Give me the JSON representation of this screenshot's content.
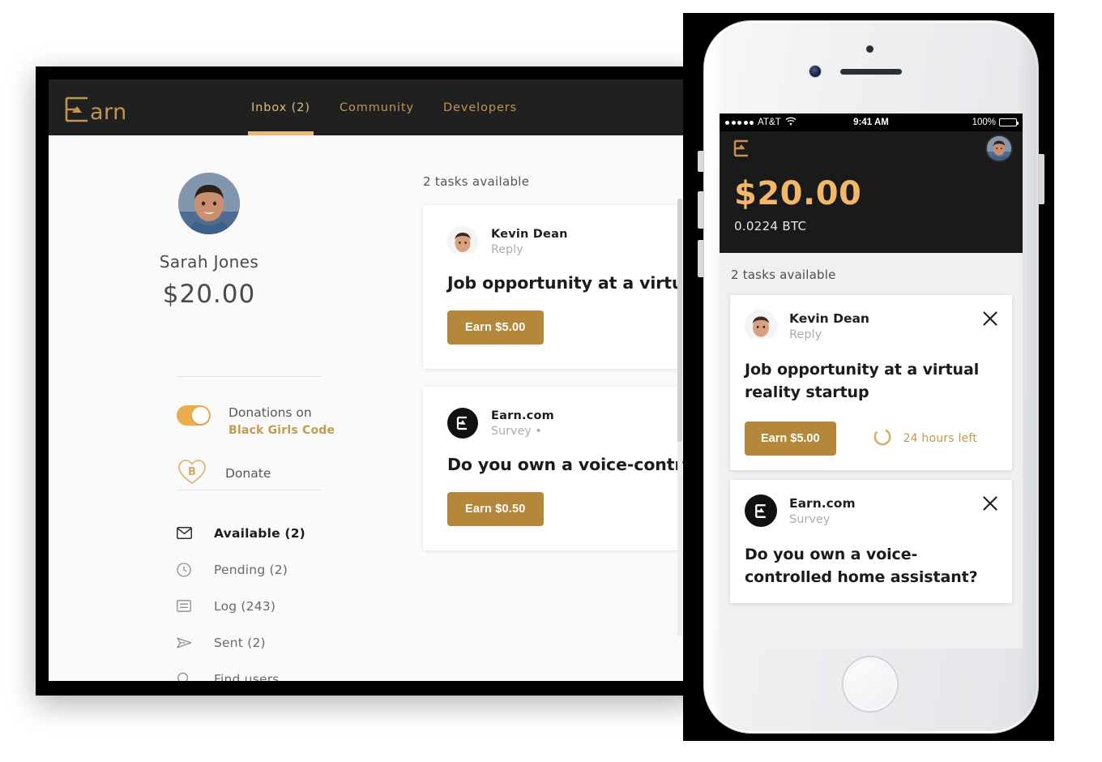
{
  "desktop": {
    "header": {
      "logo_text": "Earn",
      "logo_icon": "earn-logo-icon",
      "tabs": [
        {
          "label": "Inbox (2)",
          "active": true
        },
        {
          "label": "Community",
          "active": false
        },
        {
          "label": "Developers",
          "active": false
        }
      ]
    },
    "sidebar": {
      "avatar": "user-avatar",
      "name": "Sarah Jones",
      "balance": "$20.00",
      "donation": {
        "toggle_state": "on",
        "label": "Donations on",
        "organization": "Black Girls Code"
      },
      "donate": {
        "icon": "bitcoin-heart-icon",
        "label": "Donate"
      },
      "nav_items": [
        {
          "label": "Available (2)",
          "icon": "envelope-icon",
          "active": true
        },
        {
          "label": "Pending (2)",
          "icon": "clock-icon",
          "active": false
        },
        {
          "label": "Log (243)",
          "icon": "list-icon",
          "active": false
        },
        {
          "label": "Sent (2)",
          "icon": "paper-plane-icon",
          "active": false
        },
        {
          "label": "Find users",
          "icon": "search-icon",
          "active": false
        }
      ]
    },
    "tasks": {
      "count_label": "2 tasks available",
      "cards": [
        {
          "sender": "Kevin Dean",
          "type": "Reply",
          "title": "Job opportunity at a virtual reality startup",
          "button": "Earn $5.00",
          "avatar_kind": "photo"
        },
        {
          "sender": "Earn.com",
          "type": "Survey •",
          "title": "Do you own a voice-controlled home assistant?",
          "button": "Earn $0.50",
          "avatar_kind": "logo"
        }
      ]
    }
  },
  "phone": {
    "status_bar": {
      "carrier": "AT&T",
      "signal_dots": 5,
      "wifi": "wifi-icon",
      "time": "9:41 AM",
      "battery_percent": "100%"
    },
    "topbar": {
      "logo_icon": "earn-logo-mark-icon",
      "avatar": "user-avatar"
    },
    "balance": {
      "amount": "$20.00",
      "btc": "0.0224 BTC"
    },
    "task_count_label": "2 tasks available",
    "cards": [
      {
        "sender": "Kevin Dean",
        "type": "Reply",
        "title": "Job opportunity at a virtual reality startup",
        "button": "Earn $5.00",
        "timer_label": "24 hours left",
        "avatar_kind": "photo",
        "close_icon": "close-icon"
      },
      {
        "sender": "Earn.com",
        "type": "Survey",
        "title": "Do you own a voice-controlled home assistant?",
        "avatar_kind": "logo",
        "close_icon": "close-icon"
      }
    ]
  },
  "colors": {
    "brand_gold": "#c2944f",
    "accent_gold": "#e8b979",
    "button_bronze": "#b5873a",
    "dark_header": "#202020",
    "phone_amount_gold": "#f2b76a"
  }
}
